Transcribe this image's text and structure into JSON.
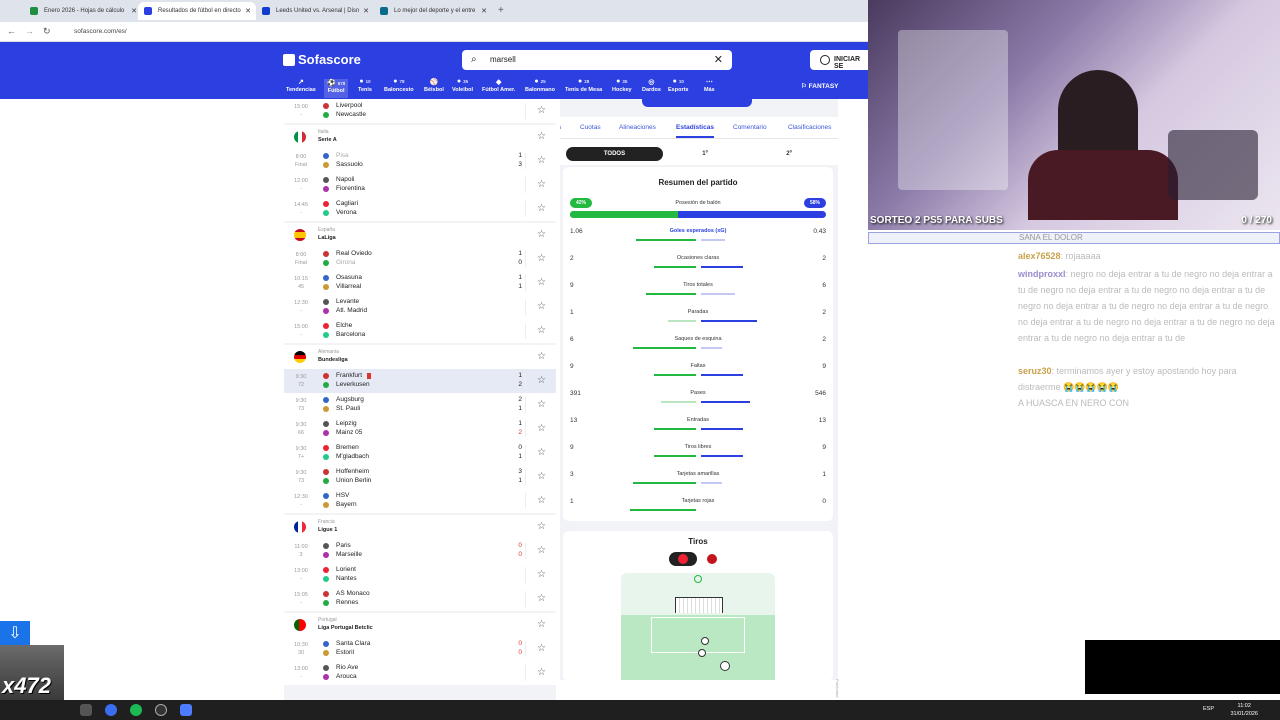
{
  "browser": {
    "tabs": [
      {
        "title": "Enero 2026 - Hojas de cálculo",
        "color": "#1e8e3e"
      },
      {
        "title": "Resultados de fútbol en directo",
        "color": "#2c3fe0"
      },
      {
        "title": "Leeds United vs. Arsenal | Disn",
        "color": "#113ccf"
      },
      {
        "title": "Lo mejor del deporte y el entre",
        "color": "#0a6b8a"
      }
    ],
    "url": "sofascore.com/es/"
  },
  "header": {
    "logo": "Sofascore",
    "search_value": "marsell",
    "login": "INICIAR SE",
    "fantasy": "FANTASY",
    "sports": [
      {
        "label": "Tendencias",
        "count": ""
      },
      {
        "label": "Fútbol",
        "count": "878"
      },
      {
        "label": "Tenis",
        "count": "10"
      },
      {
        "label": "Baloncesto",
        "count": "78"
      },
      {
        "label": "Béisbol",
        "count": ""
      },
      {
        "label": "Voleibol",
        "count": "35"
      },
      {
        "label": "Fútbol Amer.",
        "count": ""
      },
      {
        "label": "Balonmano",
        "count": "25"
      },
      {
        "label": "Tenis de Mesa",
        "count": "28"
      },
      {
        "label": "Hockey",
        "count": "35"
      },
      {
        "label": "Dardos",
        "count": ""
      },
      {
        "label": "Esports",
        "count": "10"
      },
      {
        "label": "Más",
        "count": ""
      }
    ]
  },
  "leagues": [
    {
      "country": "",
      "league": "",
      "matches": [
        {
          "time": "15:00",
          "status": "-",
          "home": "Liverpool",
          "away": "Newcastle",
          "hs": "",
          "as": ""
        }
      ]
    },
    {
      "country": "Italia",
      "league": "Serie A",
      "flag": "italy",
      "matches": [
        {
          "time": "8:00",
          "status": "Final",
          "home": "Pisa",
          "away": "Sassuolo",
          "hs": "1",
          "as": "3",
          "homeDim": true
        },
        {
          "time": "12:00",
          "status": "-",
          "home": "Napoli",
          "away": "Fiorentina",
          "hs": "",
          "as": ""
        },
        {
          "time": "14:45",
          "status": "-",
          "home": "Cagliari",
          "away": "Verona",
          "hs": "",
          "as": ""
        }
      ]
    },
    {
      "country": "España",
      "league": "LaLiga",
      "flag": "spain",
      "matches": [
        {
          "time": "8:00",
          "status": "Final",
          "home": "Real Oviedo",
          "away": "Girona",
          "hs": "1",
          "as": "0",
          "awayDim": true
        },
        {
          "time": "10:15",
          "status": "45",
          "home": "Osasuna",
          "away": "Villarreal",
          "hs": "1",
          "as": "1"
        },
        {
          "time": "12:30",
          "status": "-",
          "home": "Levante",
          "away": "Atl. Madrid",
          "hs": "",
          "as": ""
        },
        {
          "time": "15:00",
          "status": "-",
          "home": "Elche",
          "away": "Barcelona",
          "hs": "",
          "as": ""
        }
      ]
    },
    {
      "country": "Alemania",
      "league": "Bundesliga",
      "flag": "germany",
      "matches": [
        {
          "time": "9:30",
          "status": "72",
          "home": "Frankfurt",
          "away": "Leverkusen",
          "hs": "1",
          "as": "2",
          "highlight": true,
          "redcard": true
        },
        {
          "time": "9:30",
          "status": "73",
          "home": "Augsburg",
          "away": "St. Pauli",
          "hs": "2",
          "as": "1"
        },
        {
          "time": "9:30",
          "status": "66",
          "home": "Leipzig",
          "away": "Mainz 05",
          "hs": "1",
          "as": "2",
          "asRed": true
        },
        {
          "time": "9:30",
          "status": "7+",
          "home": "Bremen",
          "away": "M'gladbach",
          "hs": "0",
          "as": "1"
        },
        {
          "time": "9:30",
          "status": "73",
          "home": "Hoffenheim",
          "away": "Union Berlin",
          "hs": "3",
          "as": "1"
        },
        {
          "time": "12:30",
          "status": "-",
          "home": "HSV",
          "away": "Bayern",
          "hs": "",
          "as": ""
        }
      ]
    },
    {
      "country": "Francia",
      "league": "Ligue 1",
      "flag": "france",
      "matches": [
        {
          "time": "11:00",
          "status": "3",
          "home": "Paris",
          "away": "Marseille",
          "hs": "0",
          "as": "0",
          "redScores": true
        },
        {
          "time": "13:00",
          "status": "-",
          "home": "Lorient",
          "away": "Nantes",
          "hs": "",
          "as": ""
        },
        {
          "time": "15:05",
          "status": "-",
          "home": "AS Monaco",
          "away": "Rennes",
          "hs": "",
          "as": ""
        }
      ]
    },
    {
      "country": "Portugal",
      "league": "Liga Portugal Betclic",
      "flag": "portugal",
      "matches": [
        {
          "time": "10:30",
          "status": "30",
          "home": "Santa Clara",
          "away": "Estoril",
          "hs": "0",
          "as": "0",
          "redScores": true
        },
        {
          "time": "13:00",
          "status": "-",
          "home": "Rio Ave",
          "away": "Arouca",
          "hs": "",
          "as": ""
        }
      ]
    }
  ],
  "match_panel": {
    "subtabs": [
      "Cuotas",
      "Alineaciones",
      "Estadísticas",
      "Comentario",
      "Clasificaciones"
    ],
    "active_subtab": "Estadísticas",
    "periods": [
      "TODOS",
      "1º",
      "2º"
    ],
    "summary_title": "Resumen del partido",
    "possession": {
      "label": "Posesión de balón",
      "home": "42%",
      "away": "58%",
      "home_value": 42
    },
    "stats": [
      {
        "label": "Goles esperados (xG)",
        "home": "1.06",
        "away": "0.43",
        "h": 1.06,
        "a": 0.43,
        "link": true
      },
      {
        "label": "Ocasiones claras",
        "home": "2",
        "away": "2",
        "h": 2,
        "a": 2
      },
      {
        "label": "Tiros totales",
        "home": "9",
        "away": "6",
        "h": 9,
        "a": 6
      },
      {
        "label": "Paradas",
        "home": "1",
        "away": "2",
        "h": 1,
        "a": 2
      },
      {
        "label": "Saques de esquina",
        "home": "6",
        "away": "2",
        "h": 6,
        "a": 2
      },
      {
        "label": "Faltas",
        "home": "9",
        "away": "9",
        "h": 9,
        "a": 9
      },
      {
        "label": "Pases",
        "home": "391",
        "away": "546",
        "h": 391,
        "a": 546
      },
      {
        "label": "Entradas",
        "home": "13",
        "away": "13",
        "h": 13,
        "a": 13
      },
      {
        "label": "Tiros libres",
        "home": "9",
        "away": "9",
        "h": 9,
        "a": 9
      },
      {
        "label": "Tarjetas amarillas",
        "home": "3",
        "away": "1",
        "h": 3,
        "a": 1
      },
      {
        "label": "Tarjetas rojas",
        "home": "1",
        "away": "0",
        "h": 1,
        "a": 0
      }
    ],
    "shots_title": "Tiros",
    "sponsor": "Publicidad"
  },
  "stream": {
    "banner": "SORTEO 2 PS5 PARA SUBS",
    "counter": "0 / 270",
    "chat_header": "SANA EL DOLOR",
    "messages": [
      {
        "user": "alex76528",
        "text": ": rojaaaaa"
      },
      {
        "user": "windproxxl",
        "text": ": negro no deja entrar a tu de negro no deja entrar a tu de negro no deja entrar a tu de negro no deja entrar a tu de negro no deja entrar a tu de negro no deja entrar a tu de negro no deja entrar a tu de negro no deja entrar a tu de negro no deja entrar a tu de negro no deja entrar a tu de"
      },
      {
        "user": "seruz30",
        "text": ": terminamos ayer y estoy apostando hoy para distraerme 😭😭😭😭😭"
      },
      {
        "user": "",
        "text": "A HUASCA EN NERO CON"
      }
    ],
    "emote_text": "x472"
  },
  "taskbar": {
    "time": "11:02",
    "date": "31/01/2026",
    "lang": "ESP"
  }
}
